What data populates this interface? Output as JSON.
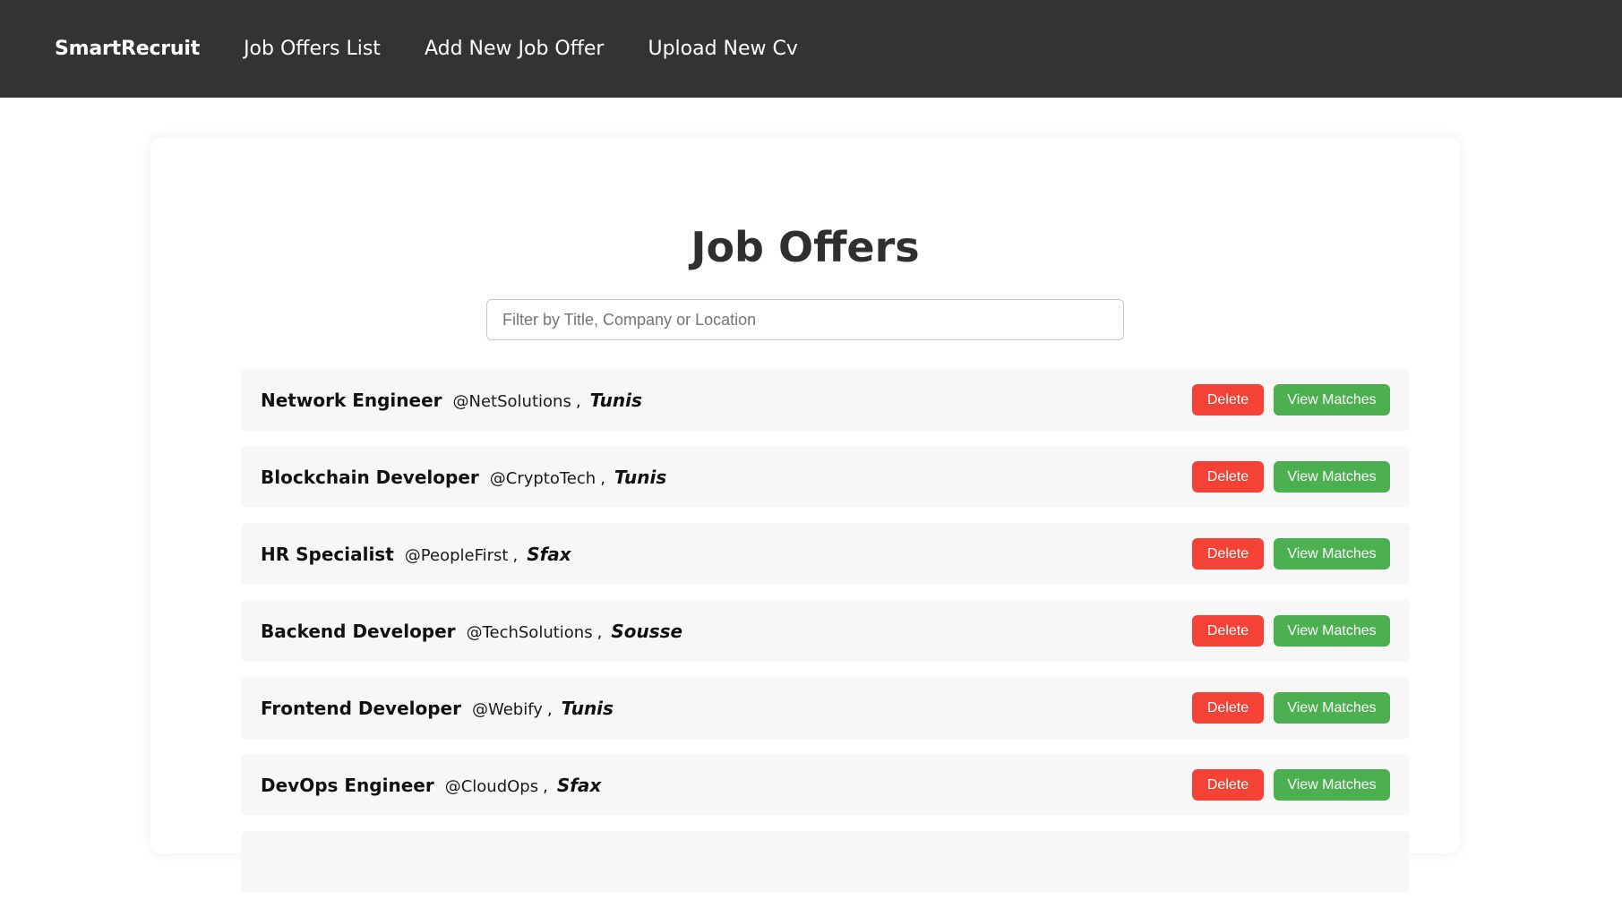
{
  "nav": {
    "brand": "SmartRecruit",
    "links": [
      "Job Offers List",
      "Add New Job Offer",
      "Upload New Cv"
    ]
  },
  "page": {
    "title": "Job Offers"
  },
  "search": {
    "placeholder": "Filter by Title, Company or Location",
    "value": ""
  },
  "offers": [
    {
      "title": "Network Engineer",
      "company": "@NetSolutions",
      "location": "Tunis"
    },
    {
      "title": "Blockchain Developer",
      "company": "@CryptoTech",
      "location": "Tunis"
    },
    {
      "title": "HR Specialist",
      "company": "@PeopleFirst",
      "location": "Sfax"
    },
    {
      "title": "Backend Developer",
      "company": "@TechSolutions",
      "location": "Sousse"
    },
    {
      "title": "Frontend Developer",
      "company": "@Webify",
      "location": "Tunis"
    },
    {
      "title": "DevOps Engineer",
      "company": "@CloudOps",
      "location": "Sfax"
    }
  ],
  "actions": {
    "delete_label": "Delete",
    "view_label": "View Matches",
    "separator": ","
  },
  "colors": {
    "topbar": "#333333",
    "delete": "#f44336",
    "view": "#4caf50",
    "row_background": "#f7f7f7"
  }
}
